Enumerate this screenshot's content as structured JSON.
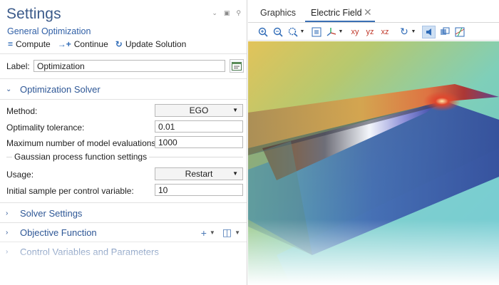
{
  "settings": {
    "title": "Settings",
    "subtitle": "General Optimization",
    "window_controls": [
      "chevron-down-icon",
      "restore-icon",
      "pin-icon"
    ],
    "toolbar": {
      "compute": "Compute",
      "continue": "Continue",
      "update_solution": "Update Solution"
    },
    "label_field": {
      "label": "Label:",
      "value": "Optimization"
    }
  },
  "sections": {
    "optimization_solver": "Optimization Solver",
    "solver_settings": "Solver Settings",
    "objective_function": "Objective Function",
    "control_variables": "Control Variables and Parameters"
  },
  "solver": {
    "method_label": "Method:",
    "method_value": "EGO",
    "tolerance_label": "Optimality tolerance:",
    "tolerance_value": "0.01",
    "max_evals_label": "Maximum number of model evaluations:",
    "max_evals_value": "1000",
    "gp_group_label": "Gaussian process function settings",
    "usage_label": "Usage:",
    "usage_value": "Restart",
    "initial_sample_label": "Initial sample per control variable:",
    "initial_sample_value": "10"
  },
  "graphics": {
    "tabs": [
      "Graphics",
      "Electric Field"
    ],
    "active_tab": "Electric Field",
    "toolbar_icons": [
      "zoom-in-icon",
      "zoom-out-icon",
      "zoom-box-icon",
      "zoom-extents-icon",
      "axis-orientation-icon",
      "xy-view-icon",
      "yz-view-icon",
      "xz-view-icon",
      "rotate-icon",
      "scene-light-icon",
      "transparency-icon",
      "grid-icon"
    ],
    "xy_label": "xy",
    "yz_label": "yz",
    "xz_label": "xz"
  },
  "colors": {
    "accent": "#2e5796",
    "link": "#2f5fa6",
    "tab_underline": "#3a6fb4",
    "field_high": "#c0392b",
    "field_mid": "#f1c40f",
    "field_low": "#2c3e9e"
  }
}
